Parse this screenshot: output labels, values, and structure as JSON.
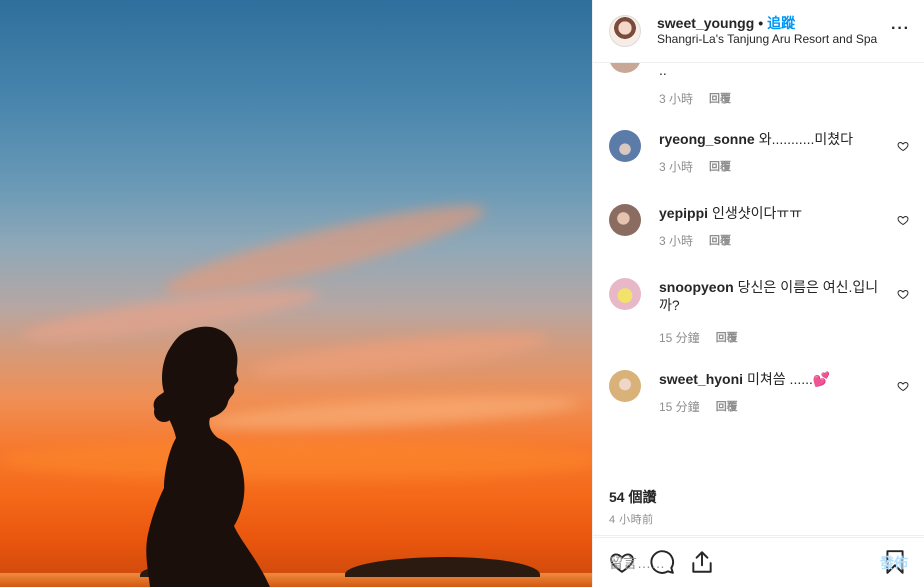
{
  "header": {
    "username": "sweet_youngg",
    "separator": "•",
    "follow_label": "追蹤",
    "location": "Shangri-La's Tanjung Aru Resort and Spa",
    "more_label": "···"
  },
  "comments": [
    {
      "username": "",
      "text": "..",
      "time": "3 小時",
      "reply": "回覆",
      "avatar_color": "#c8a796",
      "liked": false
    },
    {
      "username": "ryeong_sonne",
      "text": "와...........미쳤다",
      "time": "3 小時",
      "reply": "回覆",
      "avatar_color": "#5b7ba8",
      "liked": false
    },
    {
      "username": "yepippi",
      "text": "인생샷이다ㅠㅠ",
      "time": "3 小時",
      "reply": "回覆",
      "avatar_color": "#8a6d60",
      "liked": false
    },
    {
      "username": "snoopyeon",
      "text": "당신은 이름은 여신.입니까?",
      "time": "15 分鐘",
      "reply": "回覆",
      "avatar_color": "#e8b8c8",
      "liked": false
    },
    {
      "username": "sweet_hyoni",
      "text": "미쳐씀 ......💕",
      "time": "15 分鐘",
      "reply": "回覆",
      "avatar_color": "#d9b27a",
      "liked": false
    }
  ],
  "actions": {
    "like_icon": "heart-icon",
    "comment_icon": "comment-icon",
    "share_icon": "share-icon",
    "save_icon": "bookmark-icon"
  },
  "likes_text": "54 個讚",
  "time_ago": "4 小時前",
  "composer": {
    "placeholder": "留言……",
    "post_label": "發佈"
  },
  "colors": {
    "accent": "#0095f6",
    "post_disabled": "#b2dffc",
    "muted": "#8e8e8e"
  }
}
